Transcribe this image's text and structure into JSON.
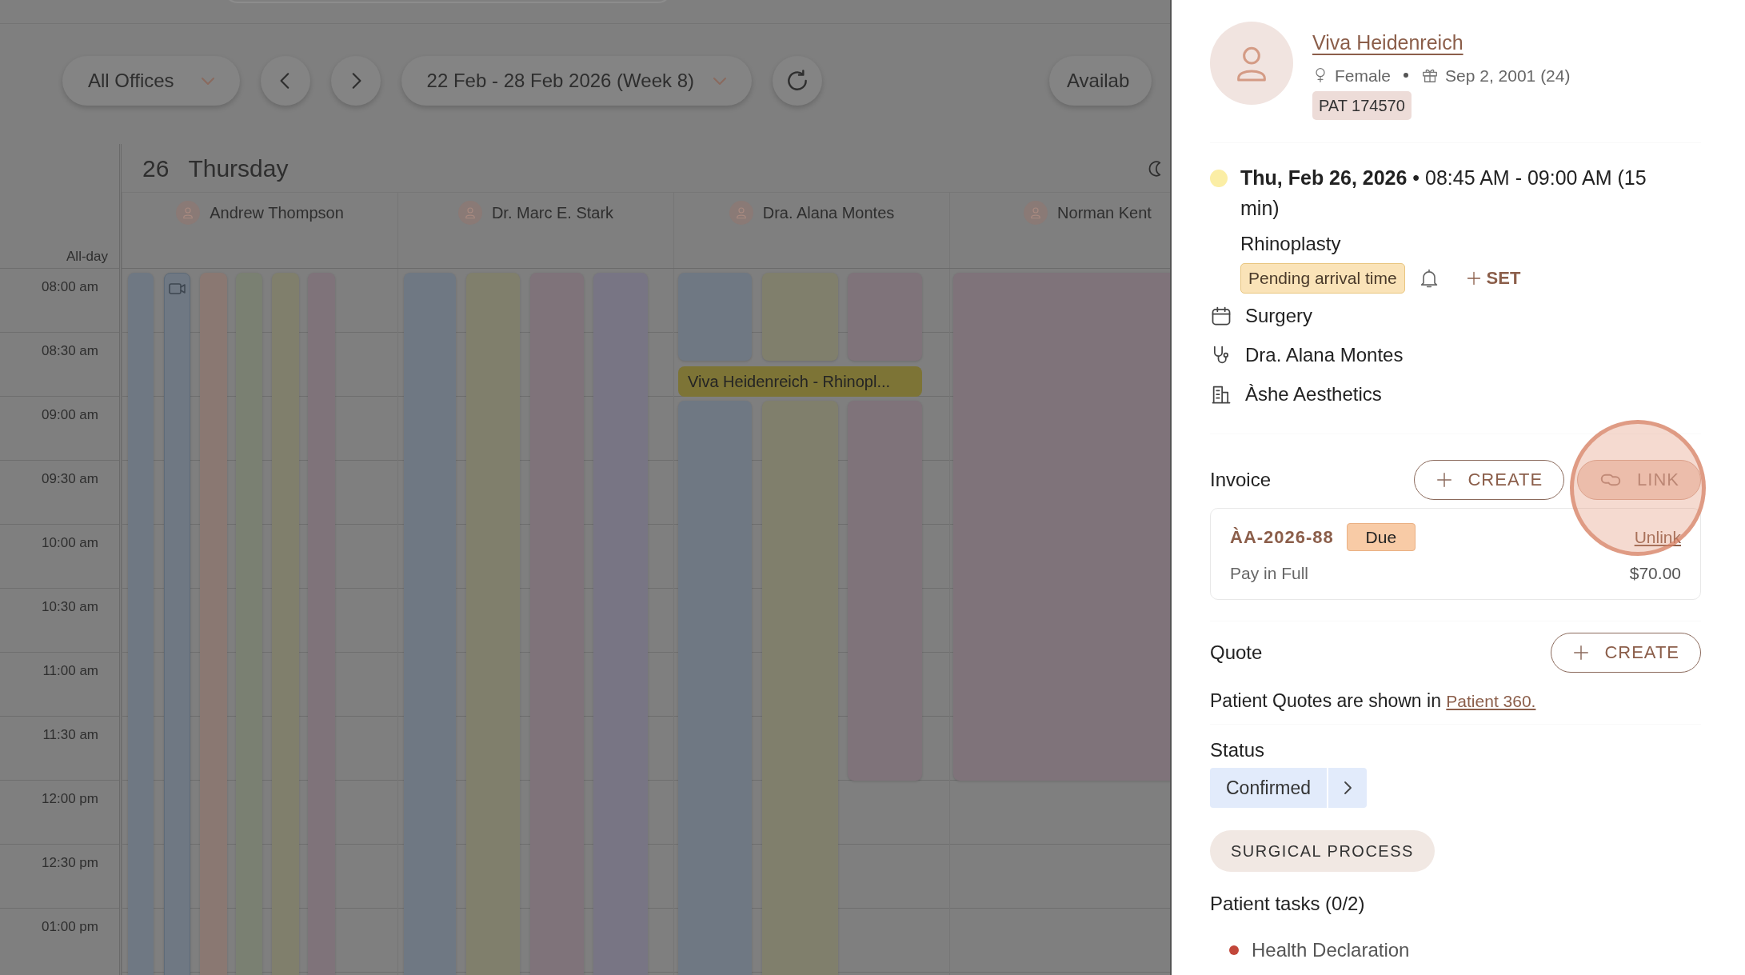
{
  "toolbar": {
    "office_filter": "All Offices",
    "date_range": "22 Feb - 28 Feb 2026 (Week 8)",
    "availability_button": "Availab"
  },
  "day": {
    "number": "26",
    "weekday": "Thursday"
  },
  "all_day_label": "All-day",
  "resources": [
    {
      "name": "Andrew Thompson",
      "blocks": [
        {
          "kind": "plain",
          "color": "#6f7883"
        },
        {
          "kind": "video",
          "color": "#6f7883"
        },
        {
          "kind": "plain",
          "color": "#8a7872"
        },
        {
          "kind": "plain",
          "color": "#7a8072"
        },
        {
          "kind": "plain",
          "color": "#807f6c"
        },
        {
          "kind": "plain",
          "color": "#7f737a"
        }
      ]
    },
    {
      "name": "Dr. Marc E. Stark",
      "blocks": [
        {
          "kind": "plain",
          "color": "#6f7883"
        },
        {
          "kind": "plain",
          "color": "#807f6c"
        },
        {
          "kind": "plain",
          "color": "#7f737a"
        },
        {
          "kind": "plain",
          "color": "#787584"
        }
      ]
    },
    {
      "name": "Dra. Alana Montes",
      "blocks": [
        {
          "kind": "plain",
          "color": "#6f7883"
        },
        {
          "kind": "plain",
          "color": "#807f6c"
        },
        {
          "kind": "plain",
          "color": "#7f737a"
        }
      ]
    },
    {
      "name": "Norman Kent",
      "blocks": [
        {
          "kind": "plain",
          "color": "#7f737a"
        }
      ]
    }
  ],
  "time_slots": [
    "08:00 am",
    "08:30 am",
    "09:00 am",
    "09:30 am",
    "10:00 am",
    "10:30 am",
    "11:00 am",
    "11:30 am",
    "12:00 pm",
    "12:30 pm",
    "01:00 pm"
  ],
  "event": {
    "title": "Viva Heidenreich - Rhinopl..."
  },
  "patient": {
    "name": "Viva Heidenreich",
    "gender": "Female",
    "birth_date": "Sep 2, 2001 (24)",
    "patient_id": "PAT 174570"
  },
  "appointment": {
    "when": "**Thu, Feb 26, 2026** • 08:45 AM - 09:00 AM (15 min)",
    "procedure": "Rhinoplasty",
    "arrival_badge": "Pending arrival time",
    "set_button": "SET",
    "details": [
      {
        "kind": "calendar",
        "text": "Surgery"
      },
      {
        "kind": "doctor",
        "text": "Dra. Alana Montes"
      },
      {
        "kind": "clinic",
        "text": "Àshe Aesthetics"
      }
    ]
  },
  "invoice": {
    "label": "Invoice",
    "create_button": "CREATE",
    "link_button": "LINK",
    "items": [
      {
        "number": "ÀA-2026-88",
        "status": "Due",
        "unlink": "Unlink",
        "payment": "Pay in Full",
        "amount": "$70.00"
      }
    ]
  },
  "quote": {
    "label": "Quote",
    "create_button": "CREATE",
    "note": "Patient Quotes are shown in",
    "note_link": "Patient 360."
  },
  "status": {
    "label": "Status",
    "value": "Confirmed"
  },
  "process_tag": "SURGICAL PROCESS",
  "patient_tasks": {
    "title": "Patient tasks (0/2)",
    "items": [
      {
        "label": "Health Declaration",
        "color": "#c2473a"
      }
    ]
  }
}
